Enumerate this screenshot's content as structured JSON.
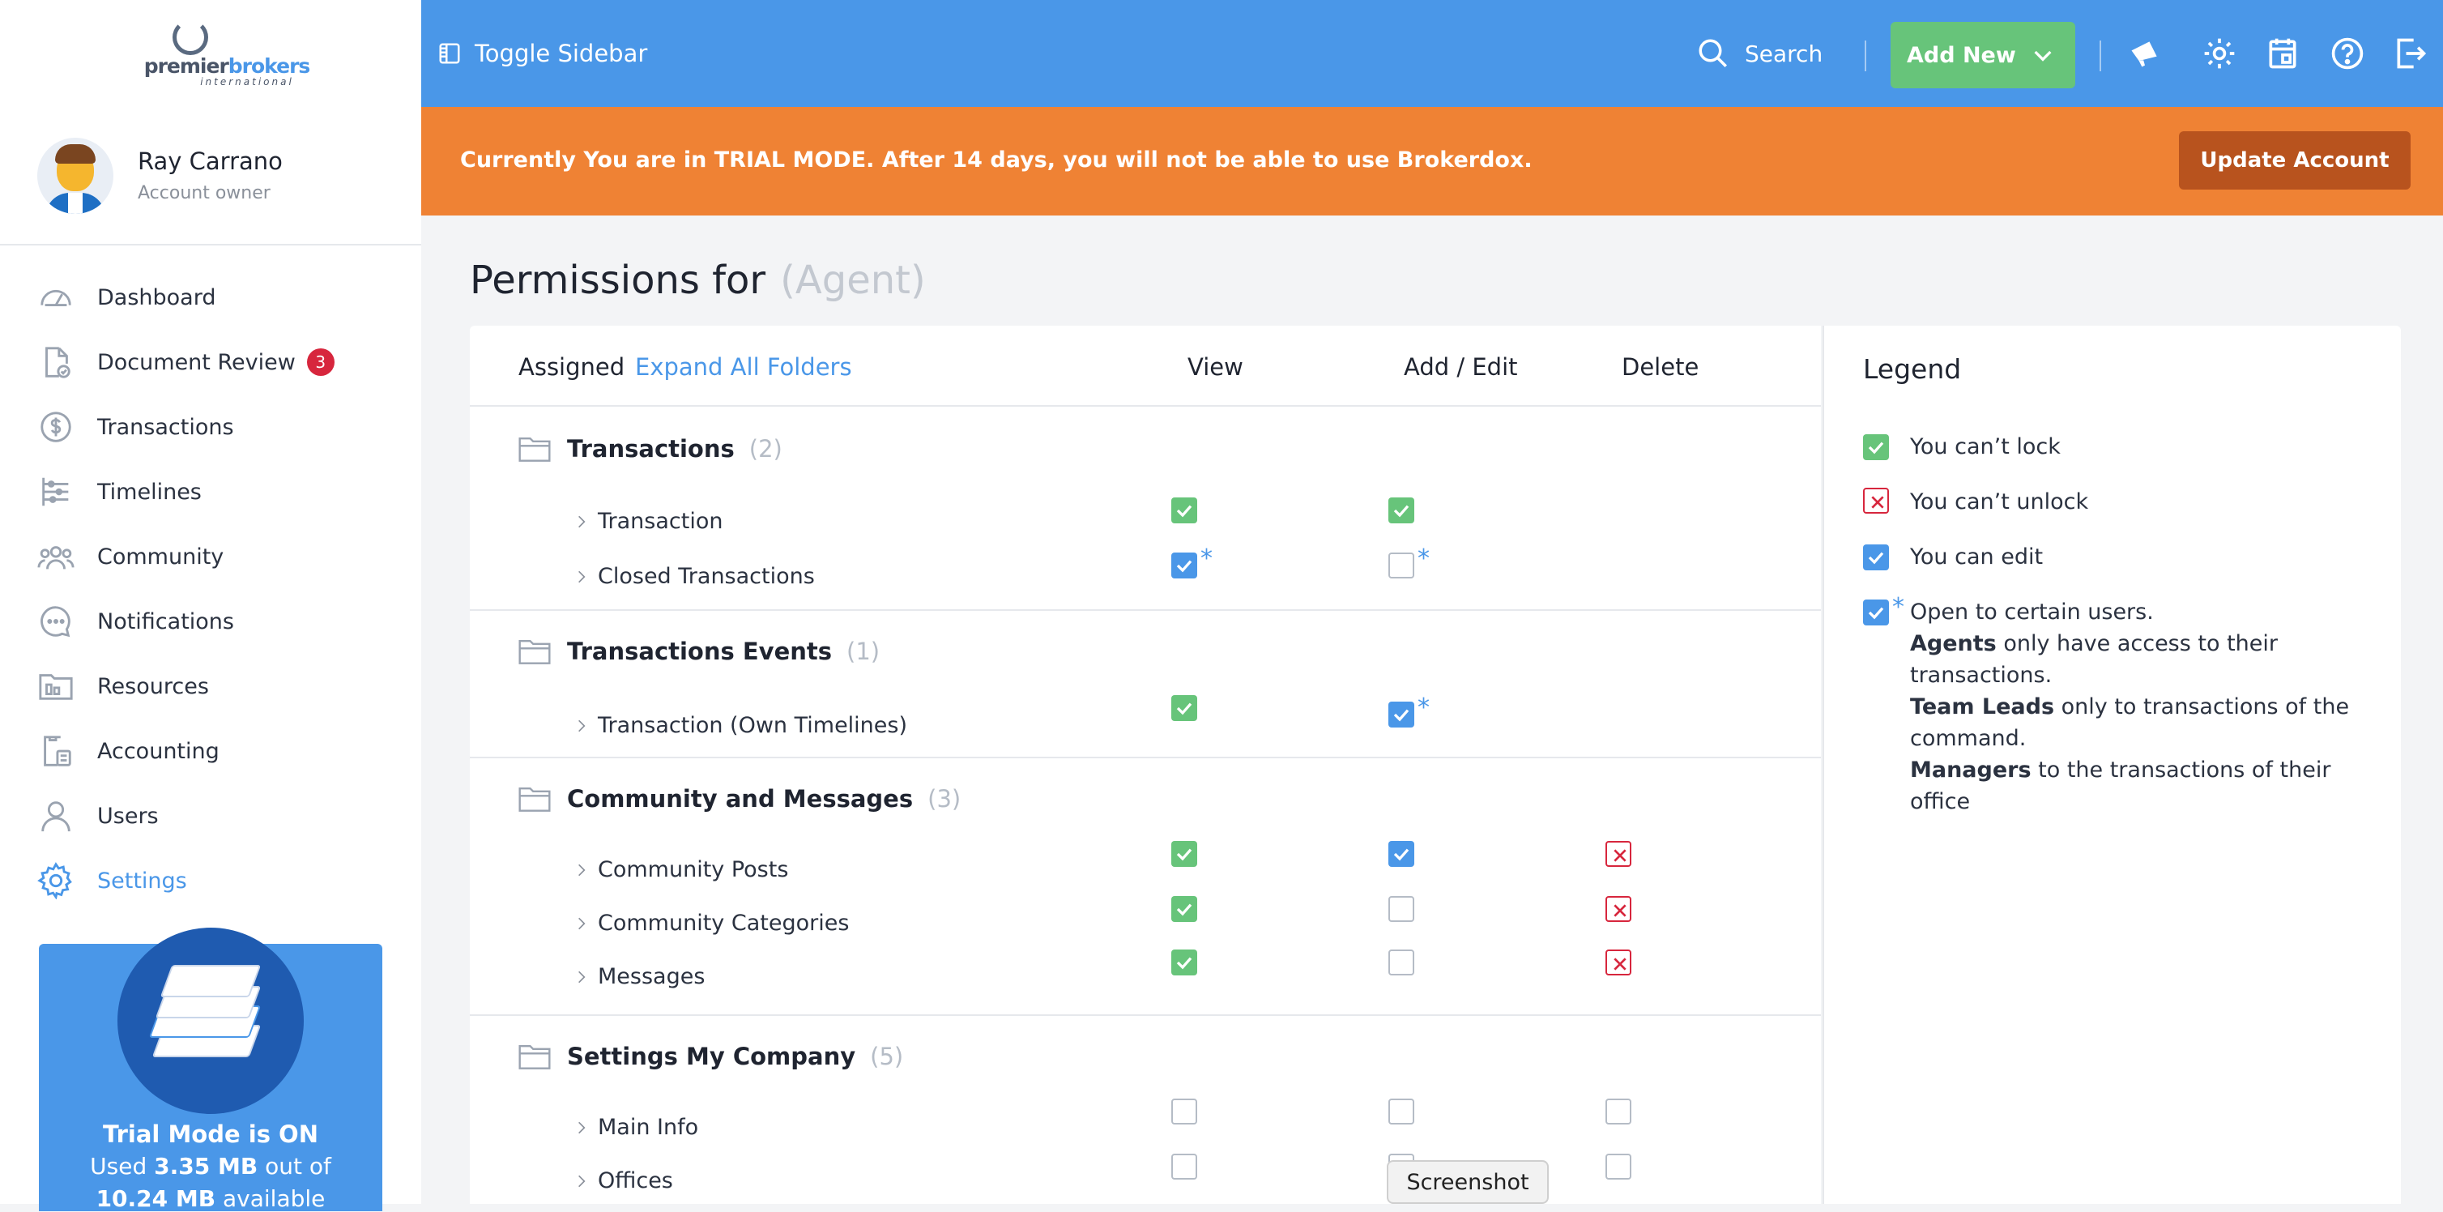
{
  "topbar": {
    "logo": {
      "brand_a": "premier",
      "brand_b": "brokers",
      "sub": "international"
    },
    "toggle_label": "Toggle Sidebar",
    "search_label": "Search",
    "add_new_label": "Add New",
    "icons": [
      "megaphone-icon",
      "gear-icon",
      "calendar-icon",
      "help-icon",
      "logout-icon"
    ]
  },
  "profile": {
    "name": "Ray Carrano",
    "role": "Account owner"
  },
  "nav": {
    "items": [
      {
        "label": "Dashboard",
        "icon": "gauge-icon"
      },
      {
        "label": "Document Review",
        "icon": "document-check-icon",
        "badge": "3"
      },
      {
        "label": "Transactions",
        "icon": "dollar-circle-icon"
      },
      {
        "label": "Timelines",
        "icon": "timeline-icon"
      },
      {
        "label": "Community",
        "icon": "people-icon"
      },
      {
        "label": "Notifications",
        "icon": "chat-bubble-icon"
      },
      {
        "label": "Resources",
        "icon": "folder-icon"
      },
      {
        "label": "Accounting",
        "icon": "calculator-icon"
      },
      {
        "label": "Users",
        "icon": "user-icon"
      },
      {
        "label": "Settings",
        "icon": "gear-icon",
        "active": true
      }
    ]
  },
  "trial_card": {
    "title": "Trial Mode is ON",
    "used_prefix": "Used ",
    "used": "3.35 MB",
    "used_mid": " out of",
    "total": "10.24 MB",
    "available": " available"
  },
  "banner": {
    "text": "Currently You are in TRIAL MODE. After 14 days, you will not be able to use Brokerdox.",
    "button": "Update Account"
  },
  "page": {
    "title": "Permissions for",
    "role": "(Agent)"
  },
  "table": {
    "headers": {
      "assigned": "Assigned",
      "expand": "Expand All Folders",
      "view": "View",
      "add_edit": "Add / Edit",
      "delete": "Delete"
    },
    "groups": [
      {
        "title": "Transactions",
        "count": "(2)",
        "rows": [
          {
            "label": "Transaction",
            "view": "green",
            "edit": "green",
            "delete": "none"
          },
          {
            "label": "Closed Transactions",
            "view": "blue-star",
            "edit": "empty-star",
            "delete": "none"
          }
        ]
      },
      {
        "title": "Transactions Events",
        "count": "(1)",
        "rows": [
          {
            "label": "Transaction (Own Timelines)",
            "view": "green",
            "edit": "blue-star",
            "delete": "none"
          }
        ]
      },
      {
        "title": "Community and Messages",
        "count": "(3)",
        "rows": [
          {
            "label": "Community Posts",
            "view": "green",
            "edit": "blue",
            "delete": "cross"
          },
          {
            "label": "Community Categories",
            "view": "green",
            "edit": "empty",
            "delete": "cross"
          },
          {
            "label": "Messages",
            "view": "green",
            "edit": "empty",
            "delete": "cross"
          }
        ]
      },
      {
        "title": "Settings My Company",
        "count": "(5)",
        "rows": [
          {
            "label": "Main Info",
            "view": "empty",
            "edit": "empty",
            "delete": "empty"
          },
          {
            "label": "Offices",
            "view": "empty",
            "edit": "empty",
            "delete": "empty"
          }
        ]
      }
    ]
  },
  "legend": {
    "title": "Legend",
    "items": [
      {
        "type": "green",
        "text": "You can’t lock"
      },
      {
        "type": "cross",
        "text": "You can’t unlock"
      },
      {
        "type": "blue",
        "text": "You can edit"
      }
    ],
    "open": {
      "line1": "Open to certain users.",
      "agents_b": "Agents",
      "agents_t1": " only have access to their",
      "agents_t2": "transactions.",
      "leads_b": "Team Leads",
      "leads_t1": " only to transactions of the",
      "leads_t2": "command.",
      "managers_b": "Managers",
      "managers_t1": " to the transactions of their",
      "managers_t2": "office"
    }
  },
  "screenshot_tooltip": "Screenshot",
  "colors": {
    "primary": "#4a97e8",
    "orange": "#ef8234",
    "green": "#67c47a",
    "red": "#d7263d",
    "dark_orange": "#b8531e"
  }
}
